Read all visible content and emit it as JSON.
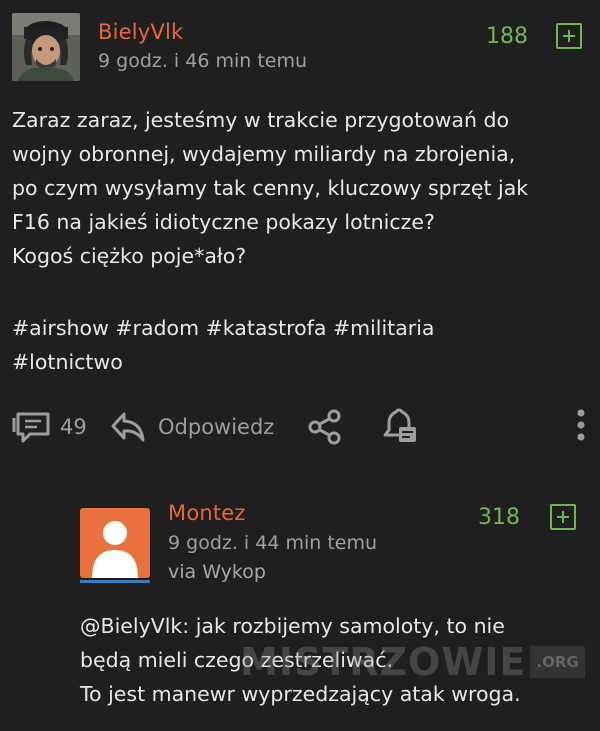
{
  "post": {
    "author": "BielyVlk",
    "time": "9 godz. i 46 min temu",
    "score": "188",
    "text": "Zaraz zaraz, jesteśmy w trakcie przygotowań do\nwojny obronnej, wydajemy miliardy na zbrojenia,\npo czym wysyłamy tak cenny, kluczowy sprzęt jak\nF16 na jakieś idiotyczne pokazy lotnicze?\nKogoś ciężko poje*ało?",
    "tags": "#airshow #radom #katastrofa #militaria\n#lotnictwo",
    "comments_count": "49",
    "reply_label": "Odpowiedz"
  },
  "reply": {
    "author": "Montez",
    "time": "9 godz. i 44 min temu",
    "via": "via Wykop",
    "score": "318",
    "text": "@BielyVlk: jak rozbijemy samoloty, to nie\nbędą mieli czego zestrzeliwać.\nTo jest manewr wyprzedzający atak wroga."
  },
  "watermark": {
    "text": "MISTRZOWIE",
    "badge": ".ORG"
  },
  "colors": {
    "background": "#1f1f1f",
    "author": "#e6683a",
    "score": "#6fb84d",
    "muted": "#9e9e9e",
    "avatar_orange": "#e8713d"
  },
  "icons": [
    "comment-icon",
    "reply-arrow-icon",
    "share-icon",
    "notification-bell-icon",
    "more-options-icon",
    "plus-icon",
    "user-placeholder-icon"
  ]
}
